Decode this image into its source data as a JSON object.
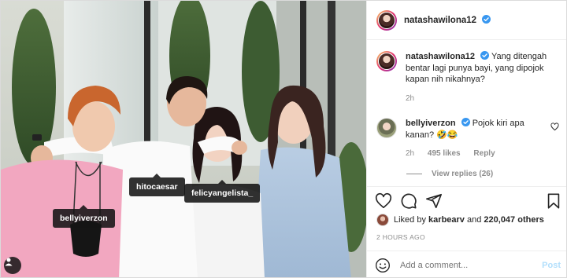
{
  "post": {
    "author": "natashawilona12",
    "verified": true,
    "caption": {
      "author": "natashawilona12",
      "text": "Yang ditengah bentar lagi punya bayi, yang dipojok kapan nih nikahnya?",
      "time": "2h"
    },
    "comment": {
      "author": "bellyiverzon",
      "text": "Pojok kiri apa kanan? 🤣😂",
      "time": "2h",
      "likes": "495 likes",
      "reply_label": "Reply",
      "view_replies": "View replies (26)"
    },
    "likes": {
      "prefix": "Liked by",
      "user": "karbearv",
      "middle": "and",
      "count": "220,047 others"
    },
    "time_ago": "2 HOURS AGO",
    "add_comment_placeholder": "Add a comment...",
    "post_label": "Post"
  },
  "photo_tags": {
    "belly": "bellyiverzon",
    "hito": "hitocaesar",
    "feli": "felicyangelista_"
  },
  "icons": {
    "verified": "verified-badge-icon",
    "heart": "heart-icon",
    "comment": "comment-icon",
    "share": "share-icon",
    "bookmark": "bookmark-icon",
    "emoji": "emoji-icon",
    "user_tags": "user-tags-icon"
  },
  "colors": {
    "verified_blue": "#3897f0",
    "post_disabled": "#b2dffc",
    "muted": "#8e8e8e"
  }
}
